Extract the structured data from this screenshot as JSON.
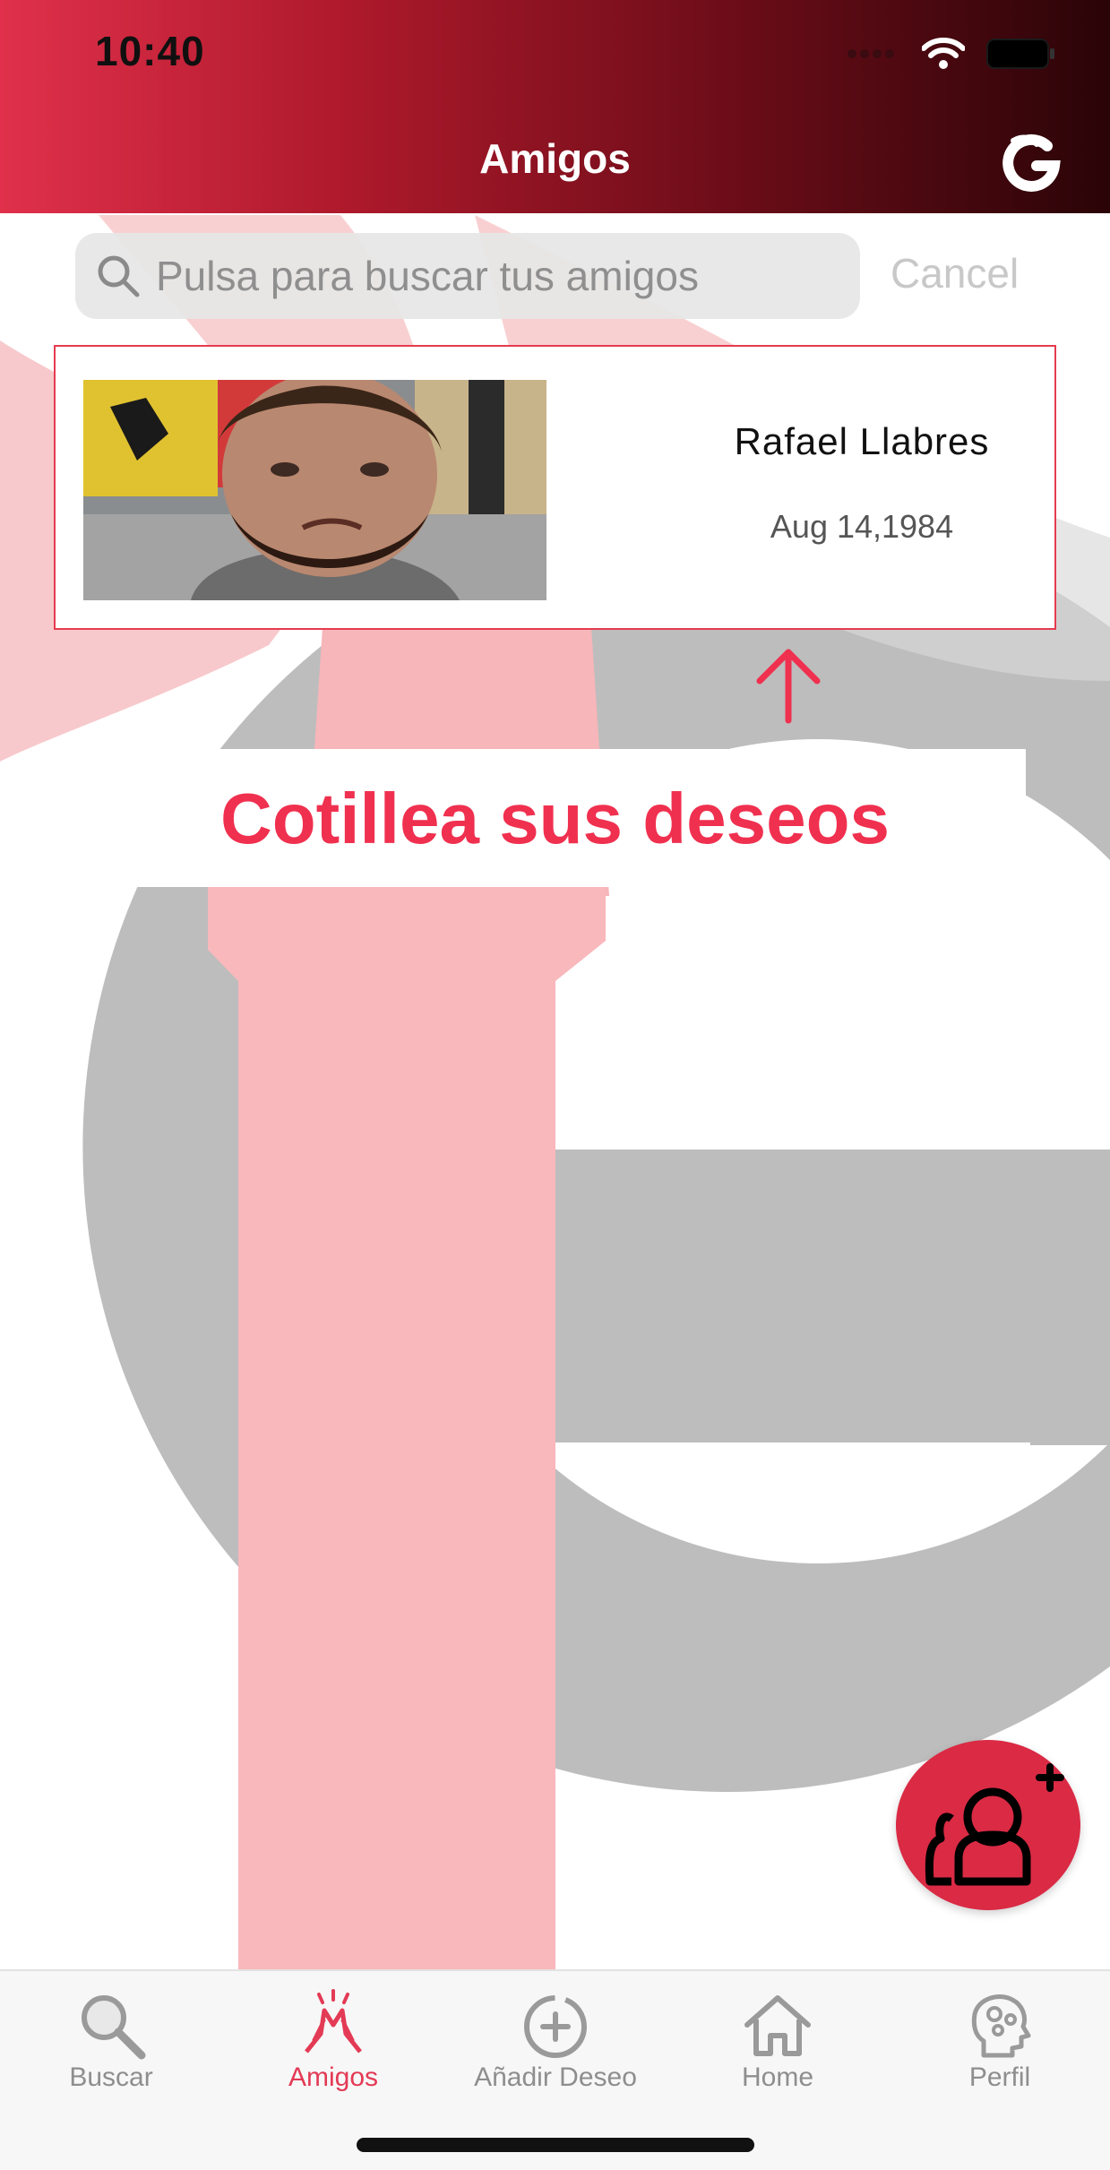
{
  "status_bar": {
    "time": "10:40"
  },
  "header": {
    "title": "Amigos"
  },
  "search": {
    "placeholder": "Pulsa para buscar tus amigos",
    "cancel_label": "Cancel"
  },
  "friends": [
    {
      "name": "Rafael Llabres",
      "birthday": "Aug 14,1984"
    }
  ],
  "tip": {
    "text": "Cotillea sus deseos"
  },
  "tab_bar": {
    "items": [
      {
        "label": "Buscar",
        "icon": "magnifier-icon"
      },
      {
        "label": "Amigos",
        "icon": "high-five-icon",
        "active": true
      },
      {
        "label": "Añadir Deseo",
        "icon": "add-circle-icon"
      },
      {
        "label": "Home",
        "icon": "house-icon"
      },
      {
        "label": "Perfil",
        "icon": "head-gears-icon"
      }
    ]
  },
  "colors": {
    "accent": "#e33a55",
    "header_start": "#e0304b",
    "header_end": "#2a0407",
    "fab": "#da2a44"
  }
}
